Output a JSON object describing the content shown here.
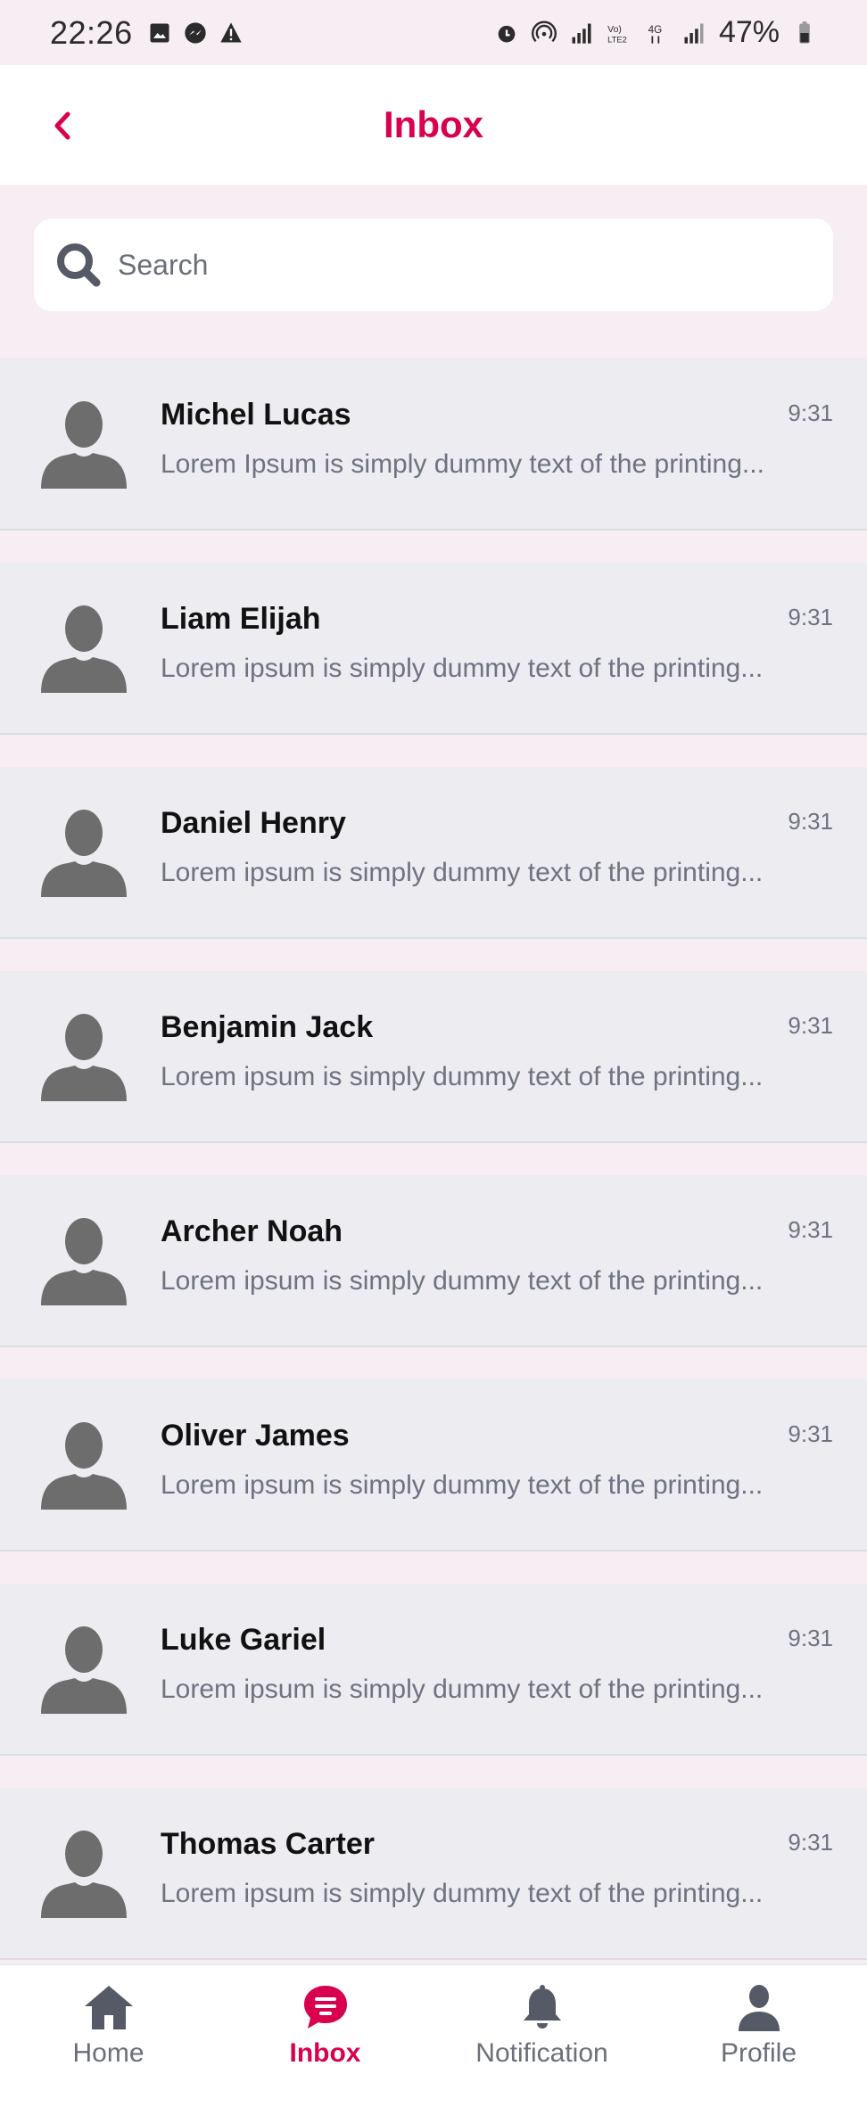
{
  "status_bar": {
    "time": "22:26",
    "battery": "47%",
    "left_icons": [
      "gallery-icon",
      "messenger-icon",
      "alert-icon"
    ],
    "right_icons": [
      "alarm-icon",
      "hotspot-icon",
      "signal-icon",
      "volte-icon",
      "4g-icon",
      "signal-icon",
      "battery-icon"
    ]
  },
  "header": {
    "title": "Inbox",
    "back_icon": "chevron-left-icon"
  },
  "search": {
    "placeholder": "Search",
    "value": ""
  },
  "conversations": [
    {
      "name": "Michel Lucas",
      "preview": "Lorem Ipsum is simply dummy text of the printing...",
      "time": "9:31"
    },
    {
      "name": "Liam Elijah",
      "preview": "Lorem ipsum is simply dummy text of the printing...",
      "time": "9:31"
    },
    {
      "name": "Daniel Henry",
      "preview": "Lorem ipsum is simply dummy text of the printing...",
      "time": "9:31"
    },
    {
      "name": "Benjamin Jack",
      "preview": "Lorem ipsum is simply dummy text of the printing...",
      "time": "9:31"
    },
    {
      "name": "Archer Noah",
      "preview": "Lorem ipsum is simply dummy text of the printing...",
      "time": "9:31"
    },
    {
      "name": "Oliver James",
      "preview": "Lorem ipsum is simply dummy text of the printing...",
      "time": "9:31"
    },
    {
      "name": "Luke Gariel",
      "preview": "Lorem ipsum is simply dummy text of the printing...",
      "time": "9:31"
    },
    {
      "name": "Thomas Carter",
      "preview": "Lorem ipsum is simply dummy text of the printing...",
      "time": "9:31"
    }
  ],
  "bottom_nav": [
    {
      "label": "Home",
      "icon": "home-icon",
      "active": false
    },
    {
      "label": "Inbox",
      "icon": "chat-icon",
      "active": true
    },
    {
      "label": "Notification",
      "icon": "bell-icon",
      "active": false
    },
    {
      "label": "Profile",
      "icon": "profile-icon",
      "active": false
    }
  ],
  "colors": {
    "accent": "#d9004f",
    "background": "#f6eef2",
    "row": "#ececf1",
    "muted": "#6b6f7a"
  }
}
